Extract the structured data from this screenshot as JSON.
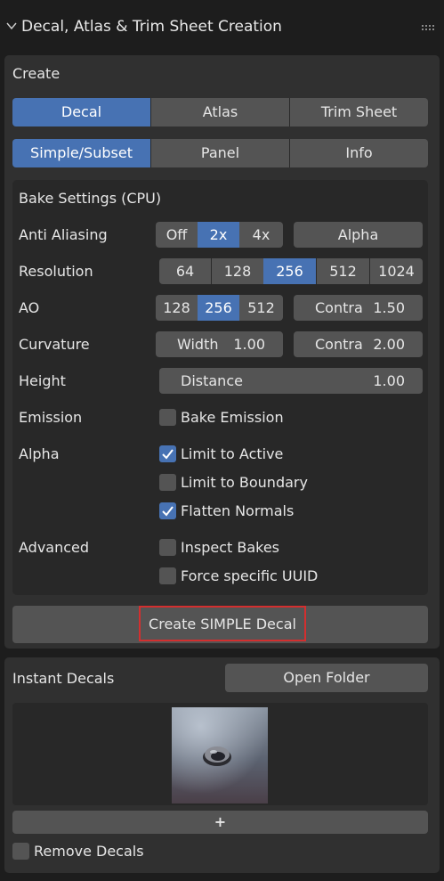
{
  "header": {
    "title": "Decal, Atlas & Trim Sheet Creation"
  },
  "create": {
    "label": "Create",
    "modes": [
      "Decal",
      "Atlas",
      "Trim Sheet"
    ],
    "active_mode": "Decal",
    "subtypes": [
      "Simple/Subset",
      "Panel",
      "Info"
    ],
    "active_subtype": "Simple/Subset"
  },
  "bake": {
    "title": "Bake Settings (CPU)",
    "anti_aliasing": {
      "label": "Anti Aliasing",
      "options": [
        "Off",
        "2x",
        "4x"
      ],
      "selected": "2x",
      "alpha_label": "Alpha"
    },
    "resolution": {
      "label": "Resolution",
      "options": [
        "64",
        "128",
        "256",
        "512",
        "1024"
      ],
      "selected": "256"
    },
    "ao": {
      "label": "AO",
      "options": [
        "128",
        "256",
        "512"
      ],
      "selected": "256",
      "contrast_label": "Contra",
      "contrast_value": "1.50"
    },
    "curvature": {
      "label": "Curvature",
      "width_label": "Width",
      "width_value": "1.00",
      "contrast_label": "Contra",
      "contrast_value": "2.00"
    },
    "height": {
      "label": "Height",
      "distance_label": "Distance",
      "distance_value": "1.00"
    },
    "emission": {
      "label": "Emission",
      "bake_emission_label": "Bake Emission",
      "bake_emission_checked": false
    },
    "alpha": {
      "label": "Alpha",
      "limit_active_label": "Limit to Active",
      "limit_active_checked": true,
      "limit_boundary_label": "Limit to Boundary",
      "limit_boundary_checked": false,
      "flatten_normals_label": "Flatten Normals",
      "flatten_normals_checked": true
    },
    "advanced": {
      "label": "Advanced",
      "inspect_bakes_label": "Inspect Bakes",
      "inspect_bakes_checked": false,
      "force_uuid_label": "Force specific UUID",
      "force_uuid_checked": false
    }
  },
  "create_button": {
    "label": "Create SIMPLE Decal",
    "highlight_color": "#d32f2f"
  },
  "instant": {
    "label": "Instant Decals",
    "open_folder_label": "Open Folder",
    "add_label": "+",
    "remove_label": "Remove Decals",
    "remove_checked": false
  },
  "colors": {
    "accent": "#4772b3",
    "button": "#545454",
    "panel": "#303030",
    "subpanel": "#282828"
  }
}
